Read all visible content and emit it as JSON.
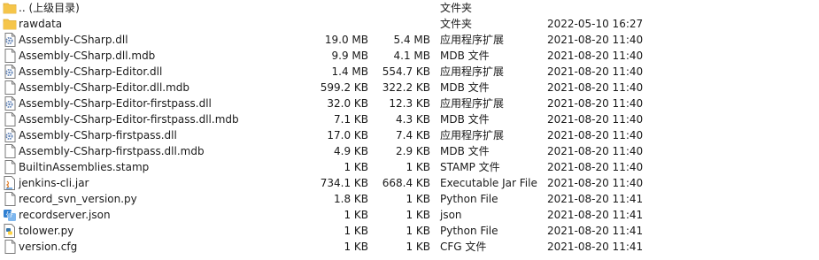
{
  "rows": [
    {
      "name": ".. (上级目录)",
      "size": "",
      "packed": "",
      "type": "文件夹",
      "date": "",
      "icon": "folder-icon"
    },
    {
      "name": "rawdata",
      "size": "",
      "packed": "",
      "type": "文件夹",
      "date": "2022-05-10 16:27",
      "icon": "folder-icon"
    },
    {
      "name": "Assembly-CSharp.dll",
      "size": "19.0 MB",
      "packed": "5.4 MB",
      "type": "应用程序扩展",
      "date": "2021-08-20 11:40",
      "icon": "dll-icon"
    },
    {
      "name": "Assembly-CSharp.dll.mdb",
      "size": "9.9 MB",
      "packed": "4.1 MB",
      "type": "MDB 文件",
      "date": "2021-08-20 11:40",
      "icon": "file-icon"
    },
    {
      "name": "Assembly-CSharp-Editor.dll",
      "size": "1.4 MB",
      "packed": "554.7 KB",
      "type": "应用程序扩展",
      "date": "2021-08-20 11:40",
      "icon": "dll-icon"
    },
    {
      "name": "Assembly-CSharp-Editor.dll.mdb",
      "size": "599.2 KB",
      "packed": "322.2 KB",
      "type": "MDB 文件",
      "date": "2021-08-20 11:40",
      "icon": "file-icon"
    },
    {
      "name": "Assembly-CSharp-Editor-firstpass.dll",
      "size": "32.0 KB",
      "packed": "12.3 KB",
      "type": "应用程序扩展",
      "date": "2021-08-20 11:40",
      "icon": "dll-icon"
    },
    {
      "name": "Assembly-CSharp-Editor-firstpass.dll.mdb",
      "size": "7.1 KB",
      "packed": "4.3 KB",
      "type": "MDB 文件",
      "date": "2021-08-20 11:40",
      "icon": "file-icon"
    },
    {
      "name": "Assembly-CSharp-firstpass.dll",
      "size": "17.0 KB",
      "packed": "7.4 KB",
      "type": "应用程序扩展",
      "date": "2021-08-20 11:40",
      "icon": "dll-icon"
    },
    {
      "name": "Assembly-CSharp-firstpass.dll.mdb",
      "size": "4.9 KB",
      "packed": "2.9 KB",
      "type": "MDB 文件",
      "date": "2021-08-20 11:40",
      "icon": "file-icon"
    },
    {
      "name": "BuiltinAssemblies.stamp",
      "size": "1 KB",
      "packed": "1 KB",
      "type": "STAMP 文件",
      "date": "2021-08-20 11:40",
      "icon": "file-icon"
    },
    {
      "name": "jenkins-cli.jar",
      "size": "734.1 KB",
      "packed": "668.4 KB",
      "type": "Executable Jar File",
      "date": "2021-08-20 11:40",
      "icon": "jar-icon"
    },
    {
      "name": "record_svn_version.py",
      "size": "1.8 KB",
      "packed": "1 KB",
      "type": "Python File",
      "date": "2021-08-20 11:41",
      "icon": "file-icon"
    },
    {
      "name": "recordserver.json",
      "size": "1 KB",
      "packed": "1 KB",
      "type": "json",
      "date": "2021-08-20 11:41",
      "icon": "json-icon"
    },
    {
      "name": "tolower.py",
      "size": "1 KB",
      "packed": "1 KB",
      "type": "Python File",
      "date": "2021-08-20 11:41",
      "icon": "python-icon"
    },
    {
      "name": "version.cfg",
      "size": "1 KB",
      "packed": "1 KB",
      "type": "CFG 文件",
      "date": "2021-08-20 11:41",
      "icon": "file-icon"
    }
  ],
  "colors": {
    "folder": "#f5c54a",
    "folder_dark": "#dca82a",
    "file_border": "#7a7a7a",
    "dll_gear": "#5b7fb5",
    "json_blue": "#2f7fd1",
    "python_blue": "#3776ab",
    "python_yellow": "#ffd343"
  }
}
